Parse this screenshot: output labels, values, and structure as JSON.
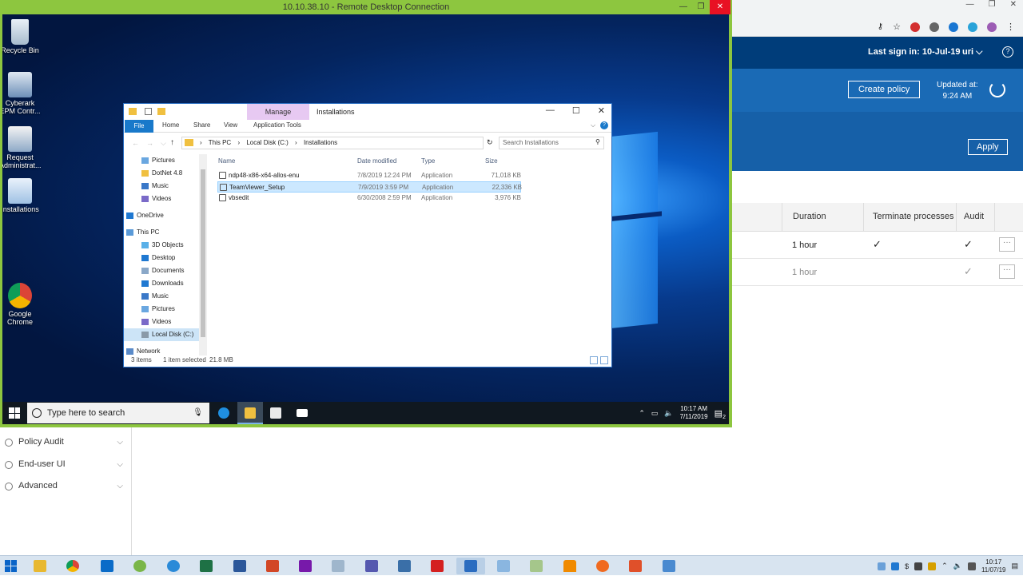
{
  "rdp": {
    "title": "10.10.38.10 - Remote Desktop Connection"
  },
  "desktop_icons": [
    {
      "label": "Recycle Bin",
      "icon": "recycle-bin-icon"
    },
    {
      "label": "Cyberark EPM Contr...",
      "icon": "cyberark-epm-icon"
    },
    {
      "label": "Request Administrat...",
      "icon": "request-admin-icon"
    },
    {
      "label": "Installations",
      "icon": "folder-icon"
    },
    {
      "label": "Google Chrome",
      "icon": "chrome-icon"
    }
  ],
  "explorer": {
    "manage_tab": "Manage",
    "window_title": "Installations",
    "ribbon_tabs": [
      "File",
      "Home",
      "Share",
      "View",
      "Application Tools"
    ],
    "breadcrumbs": [
      "This PC",
      "Local Disk (C:)",
      "Installations"
    ],
    "search_placeholder": "Search Installations",
    "nav_items": [
      {
        "label": "Pictures",
        "indent": 2
      },
      {
        "label": "DotNet 4.8",
        "indent": 2
      },
      {
        "label": "Music",
        "indent": 2
      },
      {
        "label": "Videos",
        "indent": 2
      },
      {
        "label": "OneDrive",
        "indent": 1
      },
      {
        "label": "This PC",
        "indent": 1
      },
      {
        "label": "3D Objects",
        "indent": 2
      },
      {
        "label": "Desktop",
        "indent": 2
      },
      {
        "label": "Documents",
        "indent": 2
      },
      {
        "label": "Downloads",
        "indent": 2
      },
      {
        "label": "Music",
        "indent": 2
      },
      {
        "label": "Pictures",
        "indent": 2
      },
      {
        "label": "Videos",
        "indent": 2
      },
      {
        "label": "Local Disk (C:)",
        "indent": 2,
        "selected": true
      },
      {
        "label": "Network",
        "indent": 1
      }
    ],
    "columns": [
      "Name",
      "Date modified",
      "Type",
      "Size"
    ],
    "files": [
      {
        "name": "ndp48-x86-x64-allos-enu",
        "date": "7/8/2019 12:24 PM",
        "type": "Application",
        "size": "71,018 KB",
        "selected": false
      },
      {
        "name": "TeamViewer_Setup",
        "date": "7/9/2019 3:59 PM",
        "type": "Application",
        "size": "22,336 KB",
        "selected": true
      },
      {
        "name": "vbsedit",
        "date": "6/30/2008 2:59 PM",
        "type": "Application",
        "size": "3,976 KB",
        "selected": false
      }
    ],
    "status": {
      "items": "3 items",
      "selected": "1 item selected",
      "size": "21.8 MB"
    }
  },
  "remote_taskbar": {
    "search_placeholder": "Type here to search",
    "time": "10:17 AM",
    "date": "7/11/2019",
    "notification_count": "2"
  },
  "browser_app": {
    "last_sign_in": "Last sign in: 10-Jul-19",
    "user": "uri",
    "create_policy": "Create policy",
    "updated_label": "Updated at:",
    "updated_time": "9:24 AM",
    "apply": "Apply",
    "headers": [
      "Duration",
      "Terminate processes",
      "Audit"
    ],
    "rows": [
      {
        "duration": "1 hour",
        "terminate": true,
        "audit": true,
        "dim": false
      },
      {
        "duration": "1 hour",
        "terminate": false,
        "audit": true,
        "dim": true
      }
    ]
  },
  "settings_list": [
    {
      "label": "Policy Audit",
      "icon": "policy-audit-icon"
    },
    {
      "label": "End-user UI",
      "icon": "end-user-ui-icon"
    },
    {
      "label": "Advanced",
      "icon": "advanced-icon"
    }
  ],
  "host_taskbar": {
    "time": "10:17",
    "date": "11/07/19"
  },
  "colors": {
    "rdp_frame": "#8dc63f",
    "app_header": "#003d7a",
    "app_band": "#1a6ab5",
    "selection": "#cce8ff"
  }
}
